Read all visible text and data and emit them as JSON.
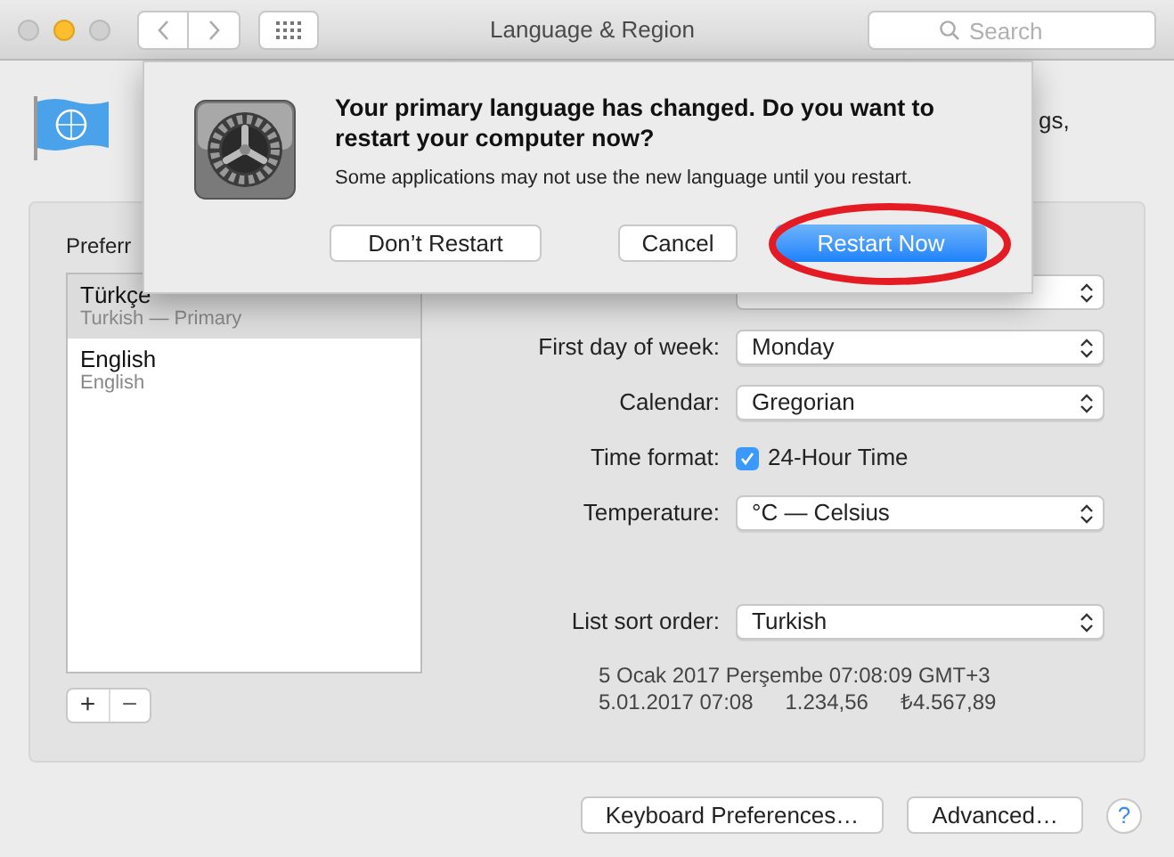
{
  "window": {
    "title": "Language & Region",
    "search": {
      "placeholder": "Search"
    }
  },
  "header": {
    "text_fragment": "gs,"
  },
  "languages_panel": {
    "label": "Preferr",
    "items": [
      {
        "name": "Türkçe",
        "detail": "Turkish — Primary",
        "selected": true
      },
      {
        "name": "English",
        "detail": "English",
        "selected": false
      }
    ],
    "add": "+",
    "remove": "−"
  },
  "settings": [
    {
      "kind": "select",
      "label": "First day of week:",
      "value": "Monday"
    },
    {
      "kind": "select",
      "label": "Calendar:",
      "value": "Gregorian"
    },
    {
      "kind": "checkbox",
      "label": "Time format:",
      "value": "24-Hour Time",
      "checked": true
    },
    {
      "kind": "select",
      "label": "Temperature:",
      "value": "°C — Celsius"
    }
  ],
  "sort_setting": {
    "label": "List sort order:",
    "value": "Turkish"
  },
  "preview": {
    "line_1": "5 Ocak 2017 Perşembe 07:08:09 GMT+3",
    "line_2": [
      "5.01.2017 07:08",
      "1.234,56",
      "₺4.567,89"
    ]
  },
  "buttons": [
    "Keyboard Preferences…",
    "Advanced…"
  ],
  "help": "?",
  "dialog": {
    "title": "Your primary language has changed. Do you want to restart your computer now?",
    "message": "Some applications may not use the new language until you restart.",
    "buttons": [
      {
        "label": "Don’t Restart",
        "kind": "plain"
      },
      {
        "label": "Cancel",
        "kind": "plain"
      },
      {
        "label": "Restart Now",
        "kind": "default",
        "highlighted": true
      }
    ]
  }
}
